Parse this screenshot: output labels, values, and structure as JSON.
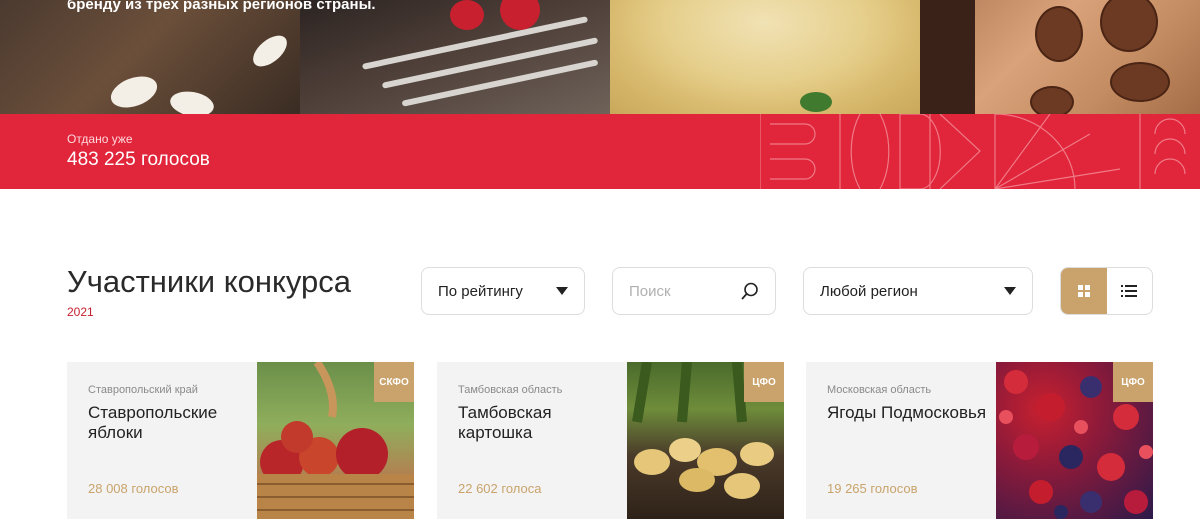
{
  "hero": {
    "caption": "бренду из трех разных регионов страны."
  },
  "votes": {
    "label": "Отдано уже",
    "count": "483 225 голосов"
  },
  "section": {
    "title": "Участники конкурса",
    "year": "2021"
  },
  "filters": {
    "sort_label": "По рейтингу",
    "search_placeholder": "Поиск",
    "region_label": "Любой регион"
  },
  "view": {
    "active": "grid",
    "icons": [
      "grid-icon",
      "list-icon"
    ]
  },
  "cards": [
    {
      "region": "Ставропольский край",
      "title": "Ставропольские яблоки",
      "votes": "28 008 голосов",
      "badge": "СКФО"
    },
    {
      "region": "Тамбовская область",
      "title": "Тамбовская картошка",
      "votes": "22 602 голоса",
      "badge": "ЦФО"
    },
    {
      "region": "Московская область",
      "title": "Ягоды Подмосковья",
      "votes": "19 265 голосов",
      "badge": "ЦФО"
    }
  ],
  "colors": {
    "accent_red": "#e1253b",
    "accent_gold": "#c9a36b"
  }
}
